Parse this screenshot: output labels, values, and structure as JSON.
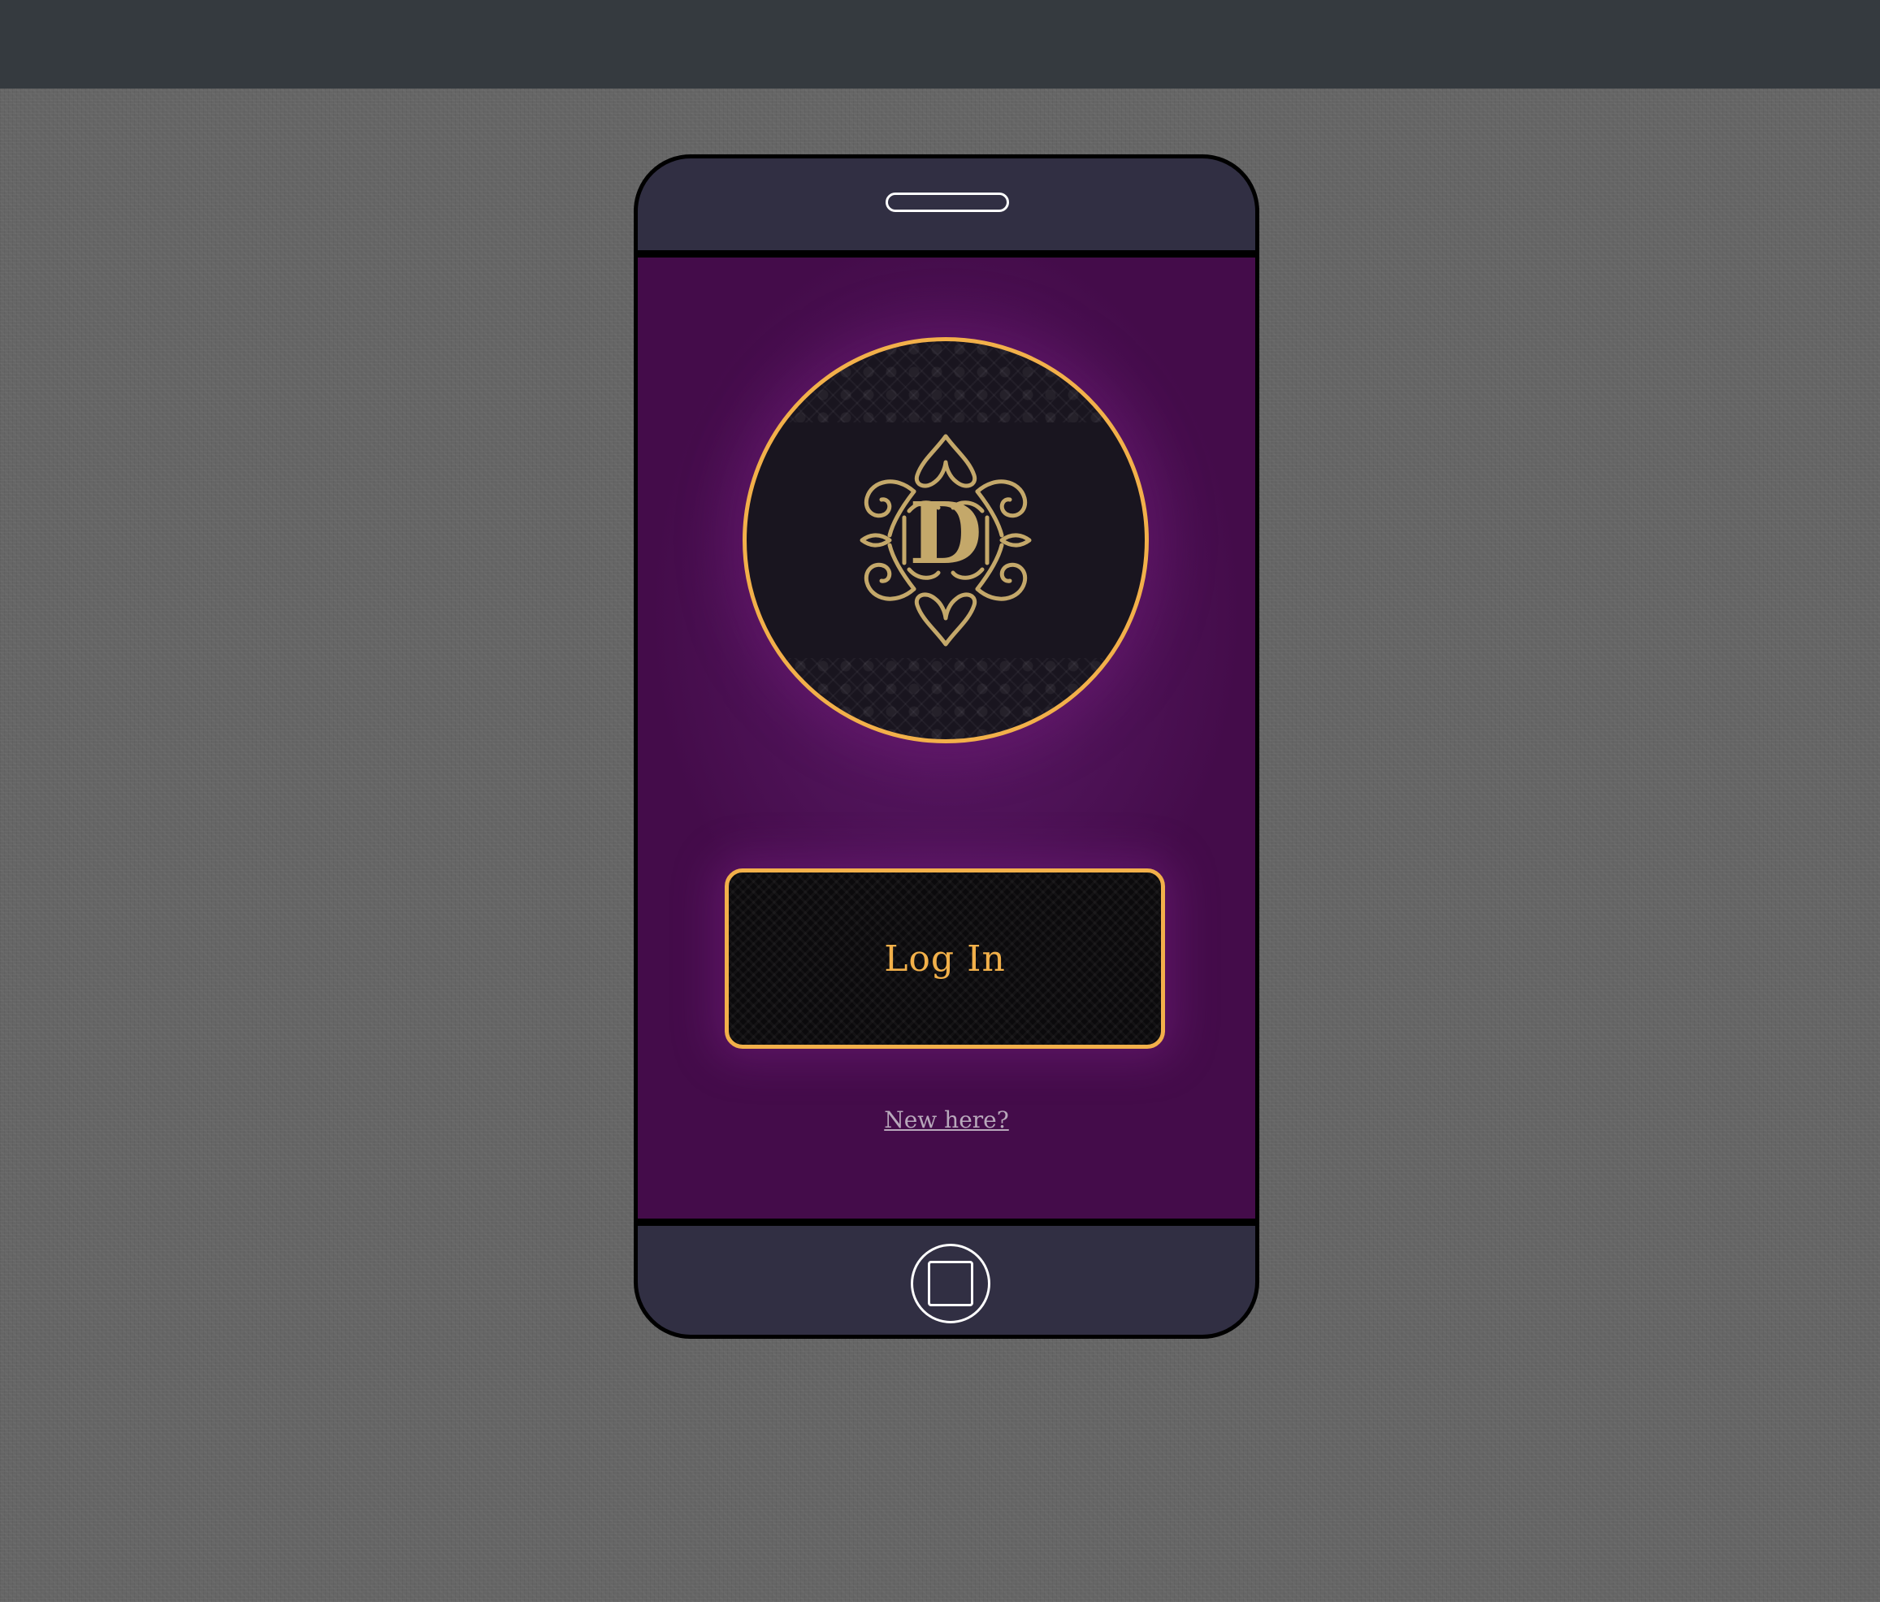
{
  "login": {
    "button_label": "Log In",
    "signup_link": "New here?"
  },
  "logo": {
    "monogram": "D",
    "icon": "ornamental-monogram-logo"
  },
  "icons": {
    "speaker": "speaker-slot-icon",
    "home": "home-button-icon"
  },
  "colors": {
    "accent": "#f2b04a",
    "screen_background": "#4f1358",
    "phone_body": "#312f43",
    "page_background": "#656565",
    "top_bar": "#353a3f",
    "logo_background": "#19151f",
    "link": "#b8a8bb"
  }
}
